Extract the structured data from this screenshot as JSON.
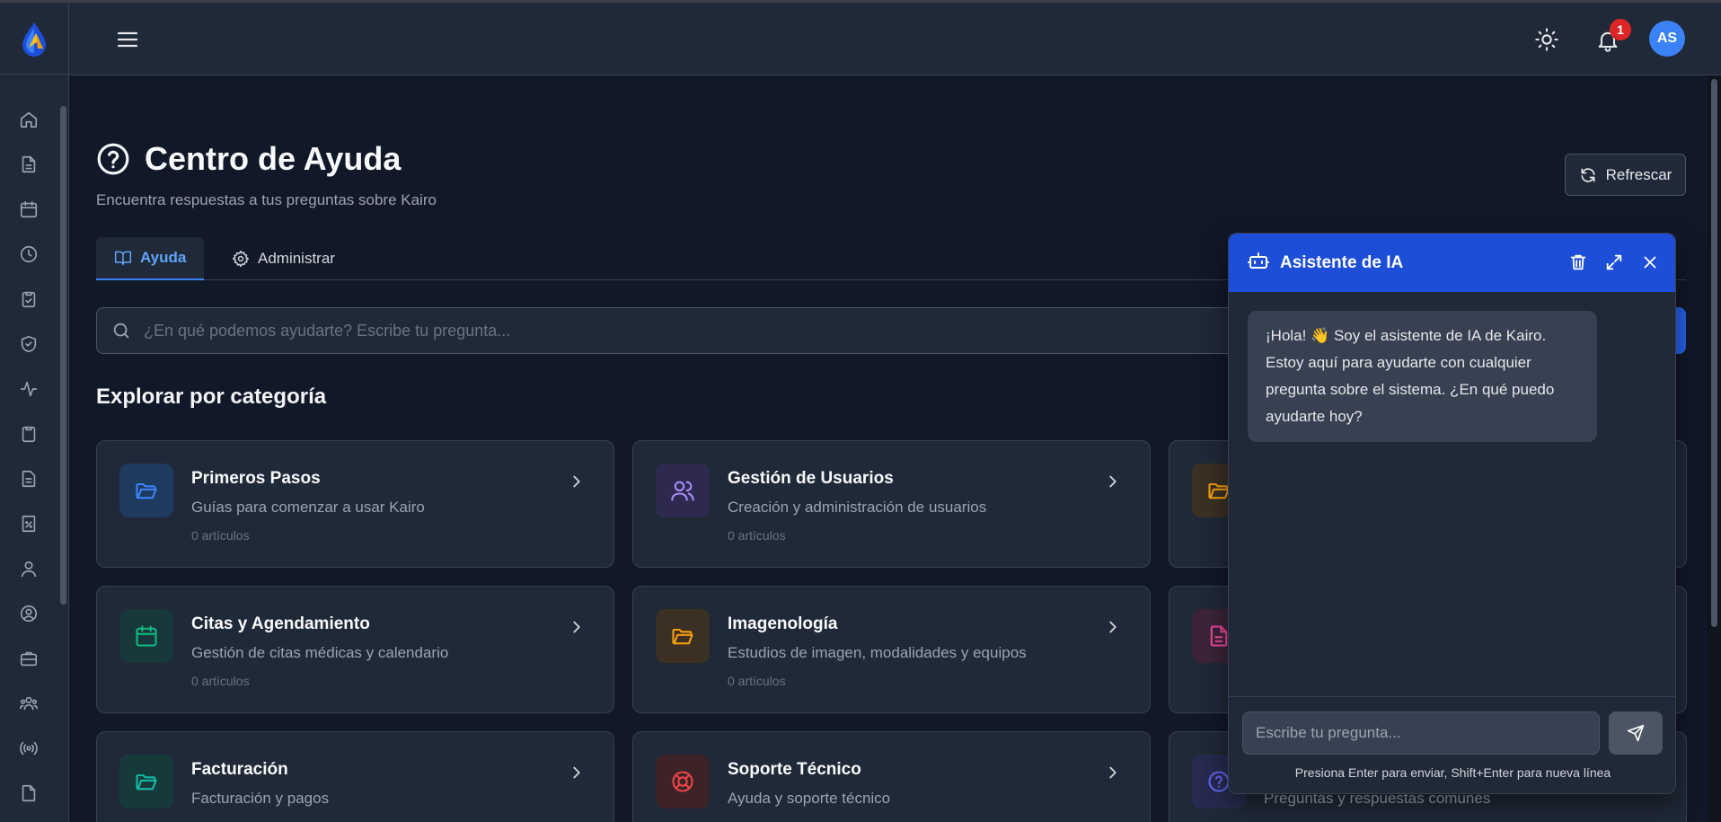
{
  "header": {
    "notification_count": "1",
    "user_initials": "AS"
  },
  "sidebar": {
    "items": [
      {
        "icon": "home-icon"
      },
      {
        "icon": "document-icon"
      },
      {
        "icon": "calendar-icon"
      },
      {
        "icon": "clock-icon"
      },
      {
        "icon": "clipboard-check-icon"
      },
      {
        "icon": "shield-check-icon"
      },
      {
        "icon": "activity-icon"
      },
      {
        "icon": "clipboard-icon"
      },
      {
        "icon": "file-text-icon"
      },
      {
        "icon": "percent-file-icon"
      },
      {
        "icon": "user-icon"
      },
      {
        "icon": "user-circle-icon"
      },
      {
        "icon": "briefcase-icon"
      },
      {
        "icon": "users-group-icon"
      },
      {
        "icon": "radio-icon"
      },
      {
        "icon": "file-icon"
      }
    ]
  },
  "page": {
    "title": "Centro de Ayuda",
    "subtitle": "Encuentra respuestas a tus preguntas sobre Kairo",
    "refresh_label": "Refrescar",
    "tabs": [
      {
        "label": "Ayuda",
        "active": true
      },
      {
        "label": "Administrar",
        "active": false
      }
    ],
    "search_placeholder": "¿En qué podemos ayudarte? Escribe tu pregunta...",
    "section_title": "Explorar por categoría"
  },
  "categories": [
    {
      "title": "Primeros Pasos",
      "description": "Guías para comenzar a usar Kairo",
      "count": "0 artículos",
      "icon": "folder-open-icon",
      "color": "#3b82f6",
      "bg": "#1e3a5f"
    },
    {
      "title": "Gestión de Usuarios",
      "description": "Creación y administración de usuarios",
      "count": "0 artículos",
      "icon": "users-icon",
      "color": "#a78bfa",
      "bg": "#2e2a4f"
    },
    {
      "title": "",
      "description": "",
      "count": "",
      "icon": "folder-open-icon",
      "color": "#f59e0b",
      "bg": "#3b3023"
    },
    {
      "title": "Citas y Agendamiento",
      "description": "Gestión de citas médicas y calendario",
      "count": "0 artículos",
      "icon": "calendar-icon",
      "color": "#10b981",
      "bg": "#17383a"
    },
    {
      "title": "Imagenología",
      "description": "Estudios de imagen, modalidades y equipos",
      "count": "0 artículos",
      "icon": "folder-open-icon",
      "color": "#f59e0b",
      "bg": "#3b3023"
    },
    {
      "title": "",
      "description": "",
      "count": "",
      "icon": "file-text-icon",
      "color": "#ec4899",
      "bg": "#3b2438"
    },
    {
      "title": "Facturación",
      "description": "Facturación y pagos",
      "count": "",
      "icon": "folder-open-icon",
      "color": "#14b8a6",
      "bg": "#163a3a"
    },
    {
      "title": "Soporte Técnico",
      "description": "Ayuda y soporte técnico",
      "count": "",
      "icon": "lifebuoy-icon",
      "color": "#ef4444",
      "bg": "#3b2328"
    },
    {
      "title": "",
      "description": "Preguntas y respuestas comunes",
      "count": "",
      "icon": "help-circle-icon",
      "color": "#6366f1",
      "bg": "#262b4f"
    }
  ],
  "chat": {
    "title": "Asistente de IA",
    "message": "¡Hola! 👋 Soy el asistente de IA de Kairo. Estoy aquí para ayudarte con cualquier pregunta sobre el sistema. ¿En qué puedo ayudarte hoy?",
    "input_placeholder": "Escribe tu pregunta...",
    "hint": "Presiona Enter para enviar, Shift+Enter para nueva línea"
  }
}
